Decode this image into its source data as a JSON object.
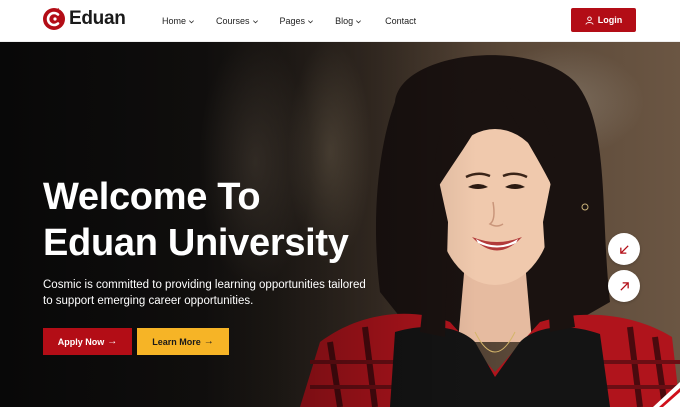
{
  "brand": {
    "name": "Eduan",
    "accent": "#b30d16"
  },
  "nav": {
    "items": [
      {
        "label": "Home",
        "has_dropdown": true
      },
      {
        "label": "Courses",
        "has_dropdown": true
      },
      {
        "label": "Pages",
        "has_dropdown": true
      },
      {
        "label": "Blog",
        "has_dropdown": true
      },
      {
        "label": "Contact",
        "has_dropdown": false
      }
    ],
    "login_label": "Login",
    "login_icon": "user-icon"
  },
  "hero": {
    "title_line1": "Welcome To",
    "title_line2": "Eduan University",
    "subtitle": "Cosmic is committed to providing learning opportunities tailored to support emerging career opportunities.",
    "apply_label": "Apply Now",
    "learn_label": "Learn More",
    "arrow_glyph": "→",
    "apply_color": "#b30d16",
    "learn_color": "#f6b426",
    "slider_prev_icon": "arrow-down-left-icon",
    "slider_next_icon": "arrow-up-right-icon"
  }
}
